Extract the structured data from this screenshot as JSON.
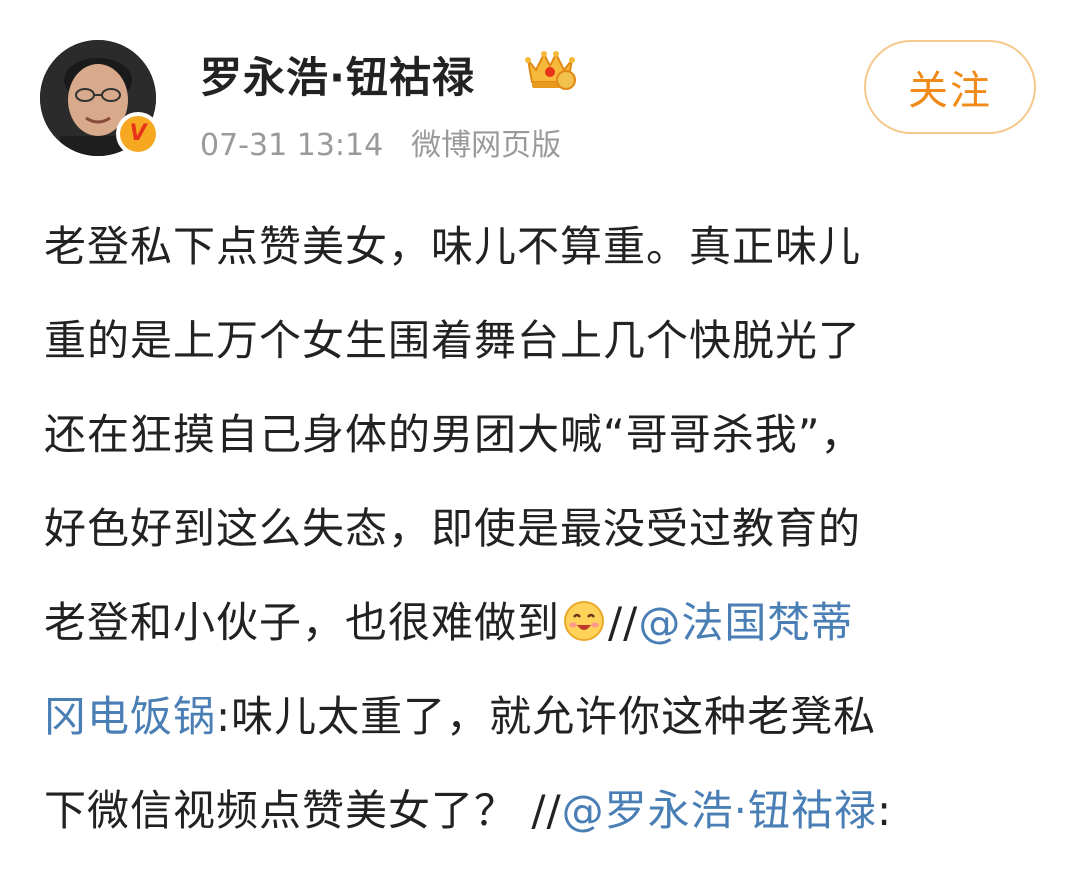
{
  "header": {
    "username": "罗永浩·钮祜禄",
    "timestamp": "07-31 13:14",
    "source": "微博网页版",
    "follow_label": "关注",
    "verified_mark": "V"
  },
  "post": {
    "line1": "老登私下点赞美女，味儿不算重。真正味儿",
    "line2": "重的是上万个女生围着舞台上几个快脱光了",
    "line3": "还在狂摸自己身体的男团大喊“哥哥杀我”，",
    "line4": "好色好到这么失态，即使是最没受过教育的",
    "line5_text": "老登和小伙子，也很难做到",
    "line5_sep": "//",
    "line5_mention": "@法国梵蒂",
    "line6_mention": "冈电饭锅",
    "line6_text": ":味儿太重了，就允许你这种老凳私",
    "line7_text": "下微信视频点赞美女了？",
    "line7_sep": " //",
    "line7_mention": "@罗永浩·钮祜禄",
    "line7_tail": ":"
  },
  "icons": {
    "avatar": "avatar",
    "verified": "verified-badge-icon",
    "vip": "crown-icon",
    "emoji": "smile-emoji-icon"
  },
  "colors": {
    "text": "#222222",
    "meta": "#9a9a9a",
    "mention": "#4a7fb5",
    "follow": "#f08b1a",
    "follow_border": "#f4c98a"
  }
}
